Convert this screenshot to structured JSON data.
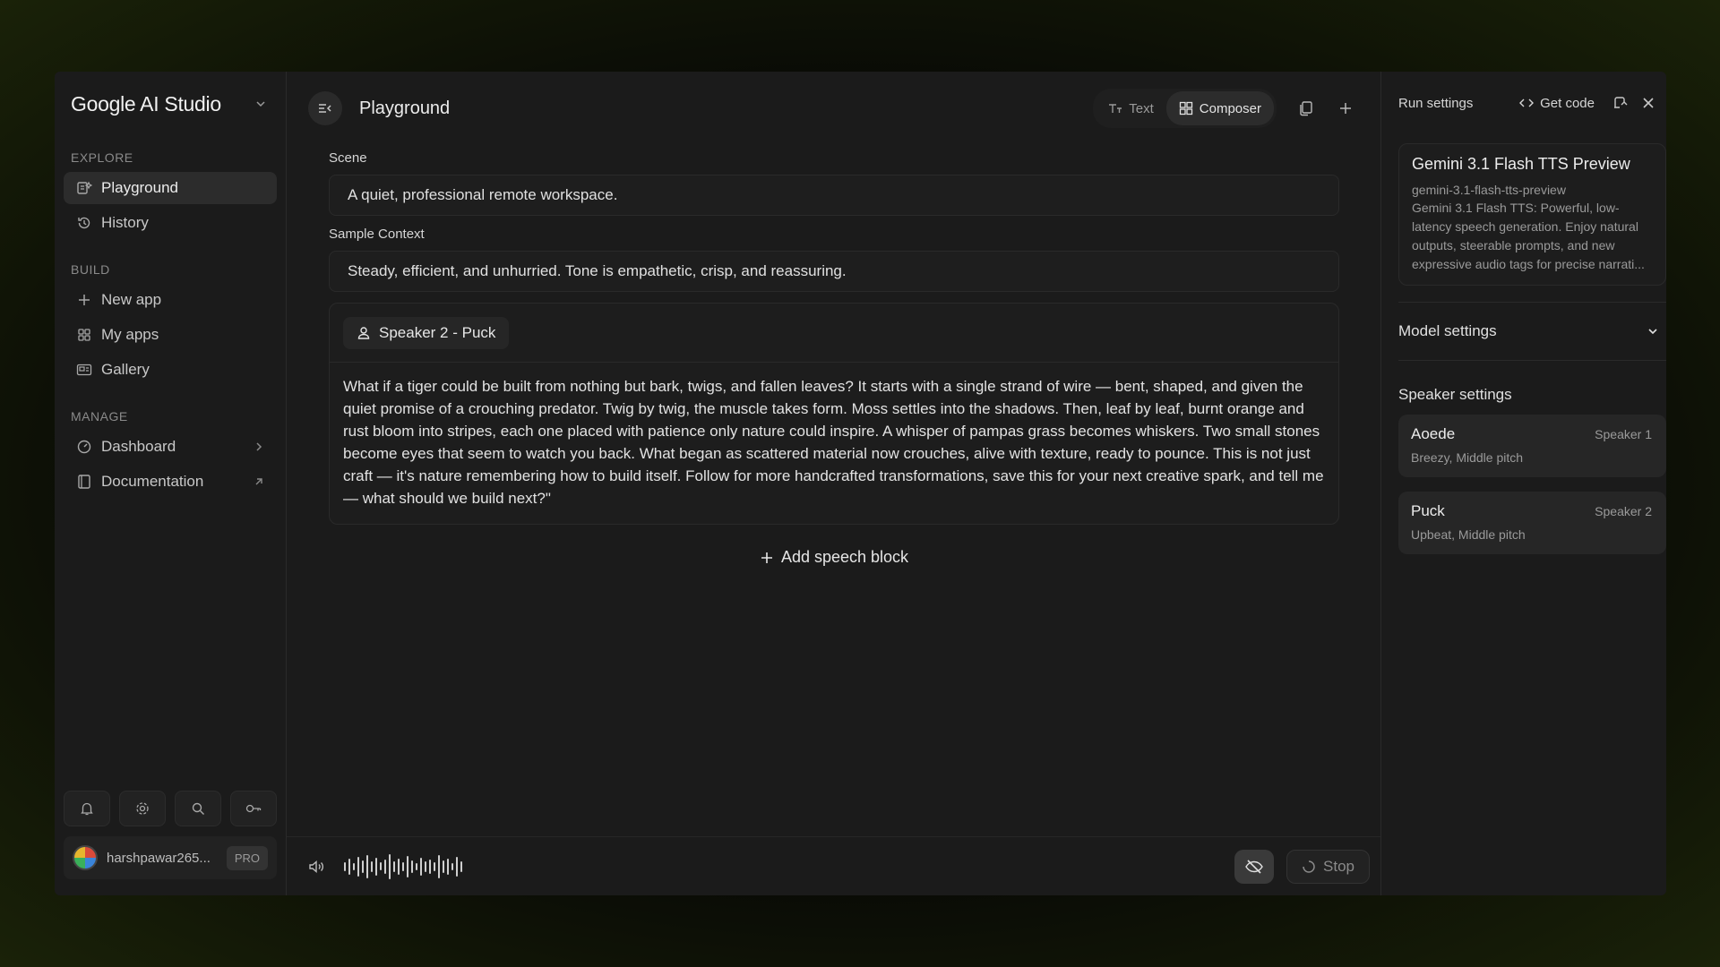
{
  "app": {
    "title": "Google AI Studio"
  },
  "sidebar": {
    "explore_label": "EXPLORE",
    "build_label": "BUILD",
    "manage_label": "MANAGE",
    "explore": [
      {
        "label": "Playground",
        "icon": "playground-icon",
        "active": true
      },
      {
        "label": "History",
        "icon": "history-icon"
      }
    ],
    "build": [
      {
        "label": "New app",
        "icon": "plus-icon"
      },
      {
        "label": "My apps",
        "icon": "grid-icon"
      },
      {
        "label": "Gallery",
        "icon": "gallery-icon"
      }
    ],
    "manage": [
      {
        "label": "Dashboard",
        "icon": "dashboard-icon"
      },
      {
        "label": "Documentation",
        "icon": "book-icon"
      }
    ],
    "bottom_icons": [
      "bell-icon",
      "gear-icon",
      "search-icon",
      "key-icon"
    ],
    "user": {
      "name": "harshpawar265...",
      "badge": "PRO"
    }
  },
  "header": {
    "title": "Playground",
    "modes": [
      {
        "label": "Text",
        "active": false
      },
      {
        "label": "Composer",
        "active": true
      }
    ]
  },
  "main": {
    "scene_label": "Scene",
    "scene_value": "A quiet, professional remote workspace.",
    "context_label": "Sample Context",
    "context_value": "Steady, efficient, and unhurried. Tone is empathetic, crisp, and reassuring.",
    "speech_block": {
      "speaker": "Speaker 2 - Puck",
      "text": "What if a tiger could be built from nothing but bark, twigs, and fallen leaves? It starts with a single strand of wire — bent, shaped, and given the quiet promise of a crouching predator. Twig by twig, the muscle takes form. Moss settles into the shadows. Then, leaf by leaf, burnt orange and rust bloom into stripes, each one placed with patience only nature could inspire. A whisper of pampas grass becomes whiskers. Two small stones become eyes that seem to watch you back. What began as scattered material now crouches, alive with texture, ready to pounce. This is not just craft — it's nature remembering how to build itself. Follow for more handcrafted transformations, save this for your next creative spark, and tell me — what should we build next?\""
    },
    "add_block_label": "Add speech block"
  },
  "player": {
    "stop_label": "Stop"
  },
  "run_settings": {
    "title": "Run settings",
    "get_code_label": "Get code",
    "model": {
      "name": "Gemini 3.1 Flash TTS Preview",
      "id": "gemini-3.1-flash-tts-preview",
      "description": "Gemini 3.1 Flash TTS: Powerful, low-latency speech generation. Enjoy natural outputs, steerable prompts, and new expressive audio tags for precise narrati..."
    },
    "model_settings_label": "Model settings",
    "speaker_settings_label": "Speaker settings",
    "speakers": [
      {
        "name": "Aoede",
        "desc": "Breezy, Middle pitch",
        "tag": "Speaker 1"
      },
      {
        "name": "Puck",
        "desc": "Upbeat, Middle pitch",
        "tag": "Speaker 2"
      }
    ]
  }
}
